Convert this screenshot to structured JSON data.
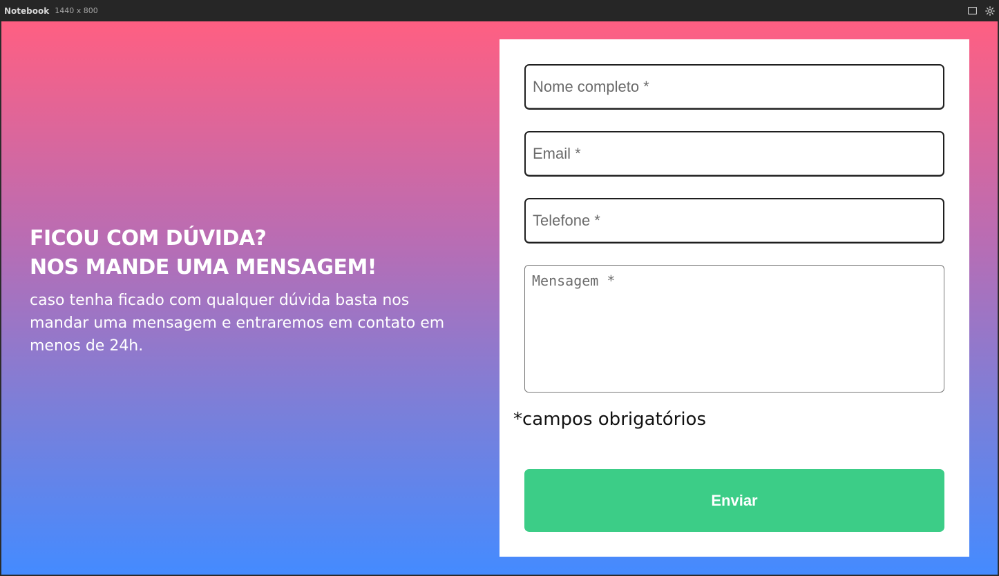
{
  "devbar": {
    "title": "Notebook",
    "size_label": "1440 x 800",
    "icons": [
      "window-icon",
      "gear-icon"
    ]
  },
  "intro": {
    "heading_line1": "FICOU COM DÚVIDA?",
    "heading_line2": "NOS MANDE UMA MENSAGEM!",
    "description": "caso tenha ficado com qualquer dúvida basta nos mandar uma mensagem e entraremos em contato em menos de 24h."
  },
  "form": {
    "name_placeholder": "Nome completo *",
    "name_value": "",
    "email_placeholder": "Email *",
    "email_value": "",
    "phone_placeholder": "Telefone *",
    "phone_value": "",
    "message_placeholder": "Mensagem *",
    "message_value": "",
    "required_note": "*campos obrigatórios",
    "submit_label": "Enviar"
  },
  "colors": {
    "gradient_top": "#ff5f82",
    "gradient_bottom": "#448bff",
    "submit_bg": "#3ccd87"
  }
}
